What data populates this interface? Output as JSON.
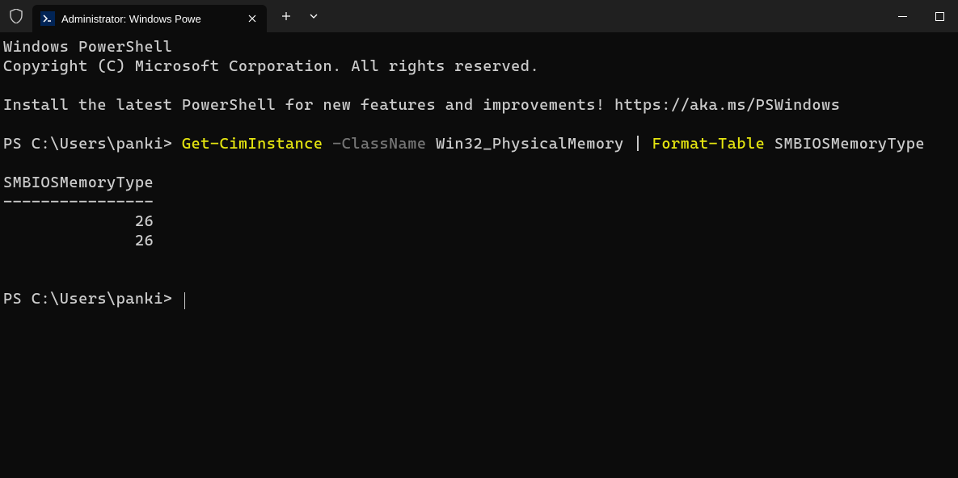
{
  "titlebar": {
    "tab_title": "Administrator: Windows Powe",
    "new_tab_label": "+",
    "close_label": "✕"
  },
  "terminal": {
    "header_line1": "Windows PowerShell",
    "header_line2": "Copyright (C) Microsoft Corporation. All rights reserved.",
    "install_msg": "Install the latest PowerShell for new features and improvements! https://aka.ms/PSWindows",
    "prompt1_prefix": "PS C:\\Users\\panki> ",
    "cmd1_part1": "Get-CimInstance",
    "cmd1_part2": " -ClassName",
    "cmd1_part3": " Win32_PhysicalMemory | ",
    "cmd1_part4": "Format-Table",
    "cmd1_part5": " SMBIOSMemoryType",
    "output_header": "SMBIOSMemoryType",
    "output_divider": "----------------",
    "output_row1": "              26",
    "output_row2": "              26",
    "prompt2_prefix": "PS C:\\Users\\panki>"
  },
  "chart_data": {
    "type": "table",
    "title": "SMBIOSMemoryType",
    "columns": [
      "SMBIOSMemoryType"
    ],
    "rows": [
      [
        26
      ],
      [
        26
      ]
    ]
  }
}
